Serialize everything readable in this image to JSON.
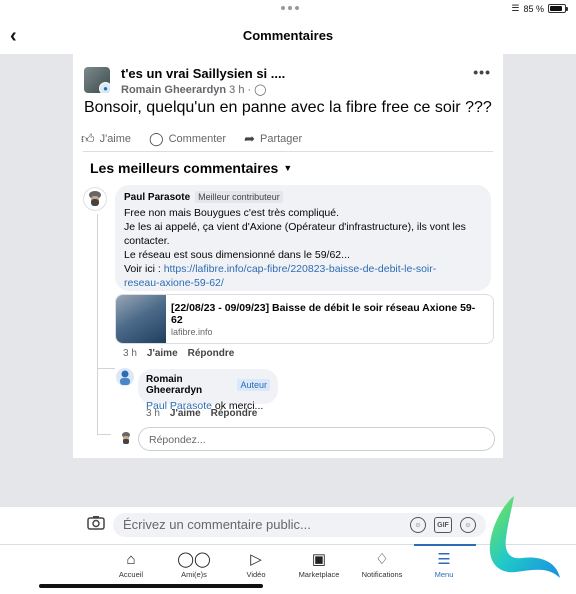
{
  "status": {
    "battery": "85 %"
  },
  "header": {
    "back_icon": "chevron-left-icon",
    "title": "Commentaires"
  },
  "post": {
    "group": "t'es un vrai Saillysien si ....",
    "author": "Romain Gheerardyn",
    "time": "3 h ·",
    "text": "Bonsoir, quelqu'un en panne avec la fibre free ce soir ???",
    "actions": {
      "like": "J'aime",
      "comment": "Commenter",
      "share": "Partager"
    }
  },
  "best_comments_label": "Les meilleurs commentaires",
  "comment1": {
    "author": "Paul Parasote",
    "badge": "Meilleur contributeur",
    "lines": [
      "Free non mais Bouygues c'est très compliqué.",
      "Je les ai appelé, ça vient d'Axione (Opérateur d'infrastructure), ils vont les",
      "contacter.",
      "Le réseau est sous dimensionné dans le 59/62...",
      "Voir ici : "
    ],
    "link_line1": "https://lafibre.info/cap-fibre/220823-baisse-de-debit-le-soir-",
    "link_line2": "reseau-axione-59-62/",
    "preview": {
      "title": "[22/08/23 - 09/09/23] Baisse de débit le soir réseau Axione 59-62",
      "domain": "lafibre.info"
    },
    "time": "3 h",
    "like": "J'aime",
    "reply": "Répondre"
  },
  "comment2": {
    "author": "Romain Gheerardyn",
    "badge": "Auteur",
    "mention": "Paul Parasote",
    "text": " ok merci...",
    "time": "3 h",
    "like": "J'aime",
    "reply": "Répondre"
  },
  "reply_placeholder": "Répondez...",
  "composer_placeholder": "Écrivez un commentaire public...",
  "tabs": [
    {
      "label": "Accueil",
      "icon": "home-icon"
    },
    {
      "label": "Ami(e)s",
      "icon": "friends-icon"
    },
    {
      "label": "Vidéo",
      "icon": "video-icon"
    },
    {
      "label": "Marketplace",
      "icon": "marketplace-icon"
    },
    {
      "label": "Notifications",
      "icon": "bell-icon"
    },
    {
      "label": "Menu",
      "icon": "menu-icon",
      "active": true
    }
  ],
  "colors": {
    "accent": "#2d6cb5",
    "bubble": "#f0f2f5"
  }
}
